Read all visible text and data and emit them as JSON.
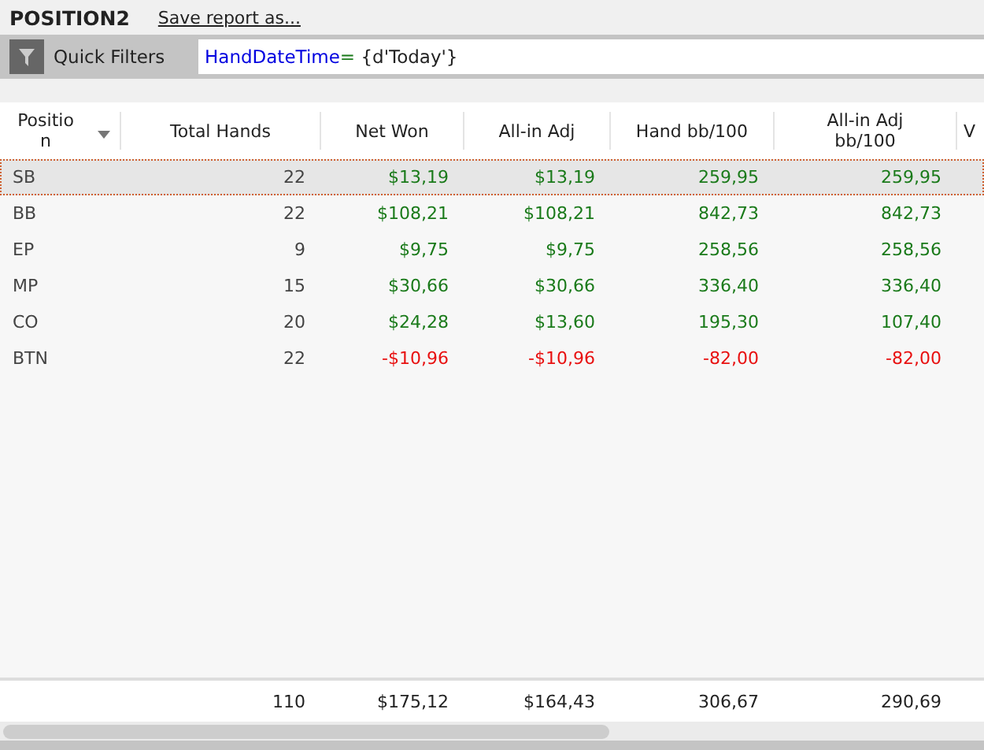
{
  "report": {
    "title": "POSITION2",
    "save_link": "Save report as..."
  },
  "quick_filters": {
    "label": "Quick Filters",
    "field": "HandDateTime",
    "operator": "=",
    "value": " {d'Today'}"
  },
  "table": {
    "columns": [
      {
        "label": "Position",
        "sorted": true
      },
      {
        "label": "Total Hands",
        "sorted": false
      },
      {
        "label": "Net Won",
        "sorted": false
      },
      {
        "label": "All-in Adj",
        "sorted": false
      },
      {
        "label": "Hand bb/100",
        "sorted": false
      },
      {
        "label": "All-in Adj bb/100",
        "sorted": false
      },
      {
        "label": "V",
        "sorted": false
      }
    ],
    "rows": [
      {
        "selected": true,
        "cells": [
          {
            "text": "SB",
            "kind": "plain"
          },
          {
            "text": "22",
            "kind": "plain"
          },
          {
            "text": "$13,19",
            "kind": "gain"
          },
          {
            "text": "$13,19",
            "kind": "gain"
          },
          {
            "text": "259,95",
            "kind": "gain"
          },
          {
            "text": "259,95",
            "kind": "gain"
          }
        ]
      },
      {
        "selected": false,
        "cells": [
          {
            "text": "BB",
            "kind": "plain"
          },
          {
            "text": "22",
            "kind": "plain"
          },
          {
            "text": "$108,21",
            "kind": "gain"
          },
          {
            "text": "$108,21",
            "kind": "gain"
          },
          {
            "text": "842,73",
            "kind": "gain"
          },
          {
            "text": "842,73",
            "kind": "gain"
          }
        ]
      },
      {
        "selected": false,
        "cells": [
          {
            "text": "EP",
            "kind": "plain"
          },
          {
            "text": "9",
            "kind": "plain"
          },
          {
            "text": "$9,75",
            "kind": "gain"
          },
          {
            "text": "$9,75",
            "kind": "gain"
          },
          {
            "text": "258,56",
            "kind": "gain"
          },
          {
            "text": "258,56",
            "kind": "gain"
          }
        ]
      },
      {
        "selected": false,
        "cells": [
          {
            "text": "MP",
            "kind": "plain"
          },
          {
            "text": "15",
            "kind": "plain"
          },
          {
            "text": "$30,66",
            "kind": "gain"
          },
          {
            "text": "$30,66",
            "kind": "gain"
          },
          {
            "text": "336,40",
            "kind": "gain"
          },
          {
            "text": "336,40",
            "kind": "gain"
          }
        ]
      },
      {
        "selected": false,
        "cells": [
          {
            "text": "CO",
            "kind": "plain"
          },
          {
            "text": "20",
            "kind": "plain"
          },
          {
            "text": "$24,28",
            "kind": "gain"
          },
          {
            "text": "$13,60",
            "kind": "gain"
          },
          {
            "text": "195,30",
            "kind": "gain"
          },
          {
            "text": "107,40",
            "kind": "gain"
          }
        ]
      },
      {
        "selected": false,
        "cells": [
          {
            "text": "BTN",
            "kind": "plain"
          },
          {
            "text": "22",
            "kind": "plain"
          },
          {
            "text": "-$10,96",
            "kind": "loss"
          },
          {
            "text": "-$10,96",
            "kind": "loss"
          },
          {
            "text": "-82,00",
            "kind": "loss"
          },
          {
            "text": "-82,00",
            "kind": "loss"
          }
        ]
      }
    ],
    "totals": [
      "110",
      "$175,12",
      "$164,43",
      "306,67",
      "290,69"
    ]
  }
}
